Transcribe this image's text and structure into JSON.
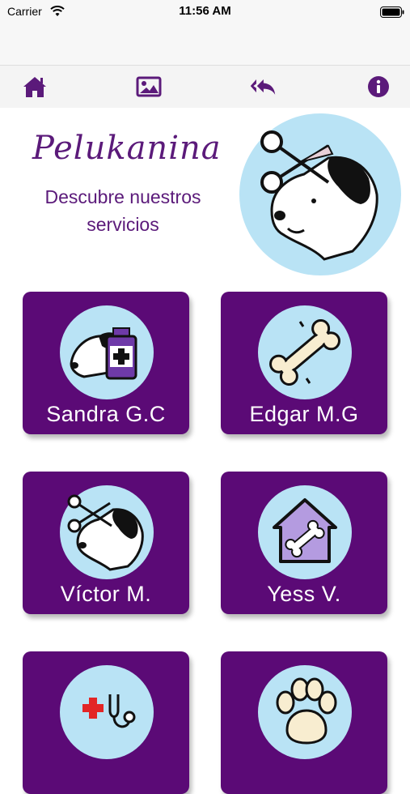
{
  "status_bar": {
    "carrier": "Carrier",
    "time": "11:56 AM"
  },
  "toolbar": {
    "items": [
      {
        "icon": "home-icon"
      },
      {
        "icon": "gallery-icon"
      },
      {
        "icon": "reply-all-icon"
      },
      {
        "icon": "info-icon"
      }
    ]
  },
  "header": {
    "brand": "Pelukanina",
    "subtitle": "Descubre nuestros servicios"
  },
  "services": [
    {
      "name": "Sandra G.C",
      "icon": "dog-medicine-icon"
    },
    {
      "name": "Edgar M.G",
      "icon": "bone-icon"
    },
    {
      "name": "Víctor M.",
      "icon": "dog-grooming-scissors-icon"
    },
    {
      "name": "Yess V.",
      "icon": "dog-house-icon"
    },
    {
      "name": "",
      "icon": "vet-stethoscope-icon"
    },
    {
      "name": "",
      "icon": "paw-icon"
    }
  ],
  "colors": {
    "primary": "#5b0a76",
    "circle": "#b9e3f5",
    "toolbar": "#f4f4f4"
  }
}
